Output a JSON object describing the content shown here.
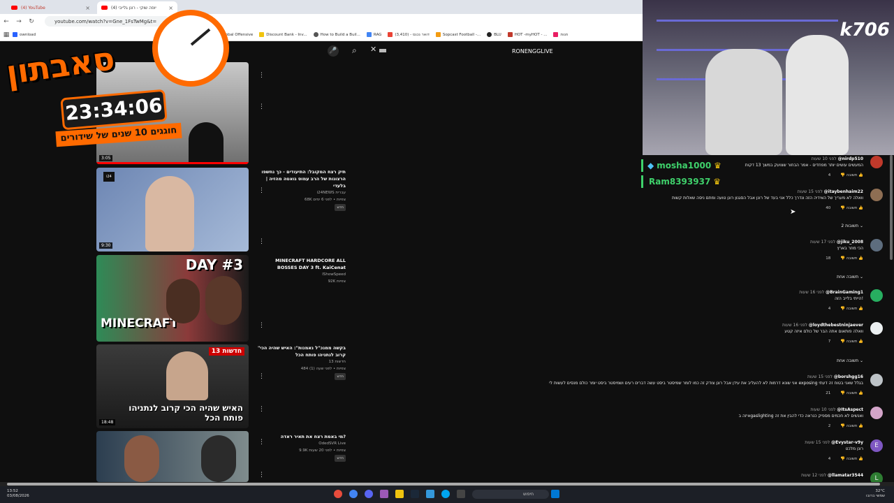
{
  "browser": {
    "tabs": [
      {
        "label": "(4) YouTube"
      },
      {
        "label": "(4) יופה שוקי - רונן גלייבי"
      }
    ],
    "url": "youtube.com/watch?v=Gne_1FsTwMg&t=",
    "bookmarks": [
      "ownload",
      "ed",
      "CS: Global Offensive",
      "Discount Bank - Inv...",
      "How to Build a Buil...",
      "RAG",
      "(3,410) - דואר נכנס",
      "Sopcast Football -...",
      "BLU",
      "HOT -myHOT - ...",
      "חנות"
    ]
  },
  "topbar": {
    "channel": "RONENGGLIVE"
  },
  "overlay": {
    "timer": "23:34:06",
    "title": "סאבתון",
    "subtitle": "חוגגים 10 שנים של שידורים"
  },
  "videos": [
    {
      "duration": "3:05",
      "title": "",
      "channel": "",
      "meta": "",
      "badge": ""
    },
    {
      "duration": "9:30",
      "title": "תיק רצח המקובל: התיעודים - כך נחשפו הרצונות של הרב עמוס גואטה מהזיה | בלעדי",
      "channel": "i24NEWS עברית",
      "meta": "68K צפיות • לפני 6 ימים",
      "badge": "חדש"
    },
    {
      "duration": "",
      "title": "MINECRAFT HARDCORE ALL BOSSES DAY 3 ft. KaiCenat",
      "channel": "IShowSpeed",
      "meta": "92K צפיות",
      "badge": "",
      "thumb_text": "DAY #3",
      "thumb_game": "MINECRAFT"
    },
    {
      "duration": "18:48",
      "title": "\"בקשה ממנכ\"ל נאמנות\": האיש שהיה הכי קרוב לנתניהו פותח הכל",
      "channel": "חדשות 13",
      "meta": "484 צפיות • לפני שעה (1)",
      "badge": "חדש",
      "thumb_text": "האיש שהיה הכי קרוב לנתניהו פותח הכל",
      "thumb_tag": "חדשות 13"
    },
    {
      "duration": "",
      "title": "מי באמת רצח את תאיר ראדה?",
      "channel": "OdedSVR Live",
      "meta": "9.9K צפיות • לפני 20 שעות",
      "badge": "חדש"
    }
  ],
  "chat": [
    {
      "user": "mosha1000"
    },
    {
      "user": "Ram8393937"
    }
  ],
  "cam": {
    "watermark": "k706"
  },
  "comments": [
    {
      "user": "@nirdp510",
      "time": "לפני 10 שעות",
      "text": "המעשים עושים יותר מפחדים - אמר הבחור שצועק במשך 13 דקות",
      "likes": "4",
      "reply": "תשובה"
    },
    {
      "user": "@itaybenhaim22",
      "time": "לפני 15 שעות",
      "text": "וואלה לא מעריך של האידיה הזה ונדרך כלל אני בעד של רונן אבל הסגנון רונן טועה ומתם ניסה שאלות קשות",
      "likes": "40",
      "reply": "תשובה",
      "replies": "2 תשובות"
    },
    {
      "user": "@jiku_2008",
      "time": "לפני 17 שעות",
      "text": "הכי מוזר בארץ",
      "likes": "18",
      "reply": "תשובה",
      "replies": "תשובה אחת"
    },
    {
      "user": "@BrainGaming1",
      "time": "לפני 16 שעות",
      "text": "הייתי בלייב הזה!",
      "likes": "4",
      "reply": "תשובה"
    },
    {
      "user": "@loydthebestninjaever",
      "time": "לפני 16 שעות",
      "text": "וואלה פותאום אתה הבר של כולם איזה קטע",
      "likes": "7",
      "reply": "תשובה",
      "replies": "תשובה אחת"
    },
    {
      "user": "@borshgg16",
      "time": "לפני 15 שעות",
      "text": "אני שונא דרמות לא להעליב את עידן אבל רונן צודק זה כמו לומר שמיסטר ביסט עשה דברים רעים ושמיסטר ביסט יומר כולם מנסים לעשות לי exposing בגלל שאני בטוח זה דעתי",
      "likes": "21",
      "reply": "תשובה"
    },
    {
      "user": "@ItsAspect",
      "time": "לפני 10 שעות",
      "text": "איזה בgaslighting ואנשים לא חכמים מספיק כנראה כדי להבין את זה",
      "likes": "2",
      "reply": "תשובה"
    },
    {
      "user": "@Evystar-v9y",
      "time": "לפני 15 שעות",
      "text": "רונן מלכט",
      "likes": "4",
      "reply": "תשובה"
    },
    {
      "user": "@llamatar3544",
      "time": "לפני 12 שעות",
      "text": "",
      "likes": "",
      "reply": ""
    }
  ],
  "taskbar": {
    "time": "13:52",
    "date": "03/08/2026",
    "search": "חיפוש",
    "temp": "32°C",
    "weather": "שמשי ברובו"
  },
  "colors": {
    "accent": "#ff0000",
    "overlay_orange": "#ff6a00",
    "chat_green": "#3fd16b"
  }
}
